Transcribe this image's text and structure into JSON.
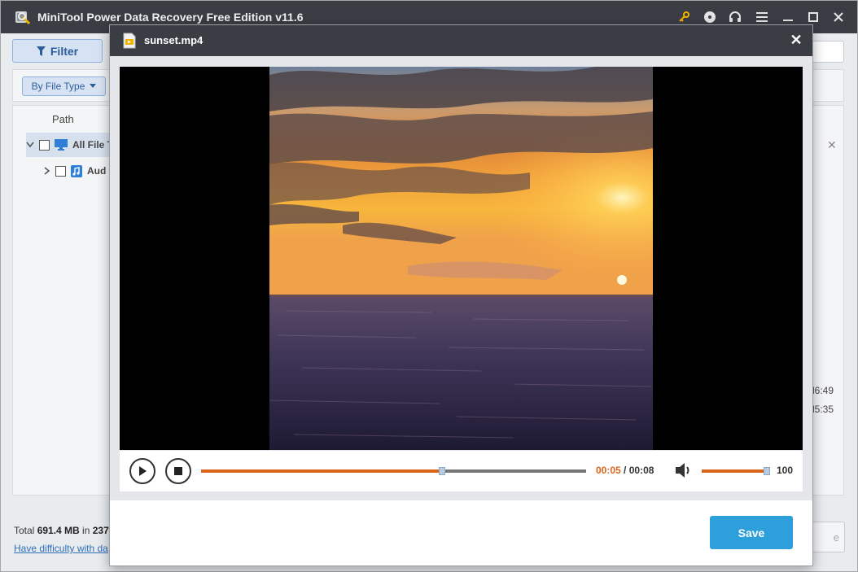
{
  "app": {
    "title": "MiniTool Power Data Recovery Free Edition v11.6",
    "filter_label": "Filter",
    "by_file_type_label": "By File Type",
    "path_header": "Path",
    "tree": [
      {
        "label": "All File T",
        "icon": "monitor-icon",
        "expanded": true
      },
      {
        "label": "Aud",
        "icon": "audio-file-icon",
        "expanded": false
      }
    ],
    "time_fragments": [
      "l6:49",
      "l5:35"
    ],
    "footer": {
      "total_prefix": "Total ",
      "total_size": "691.4 MB",
      "total_mid": " in ",
      "total_count": "237",
      "help_link": "Have difficulty with da",
      "button_fragment": "e"
    }
  },
  "dialog": {
    "title": "sunset.mp4",
    "player": {
      "current_time": "00:05",
      "separator": " / ",
      "total_time": "00:08",
      "progress": 0.625,
      "volume": 100
    },
    "save_label": "Save"
  },
  "colors": {
    "titlebar": "#3b3d44",
    "accent_orange": "#d9651c",
    "save_blue": "#2d9fdb",
    "filter_blue": "#2c5d9c"
  }
}
